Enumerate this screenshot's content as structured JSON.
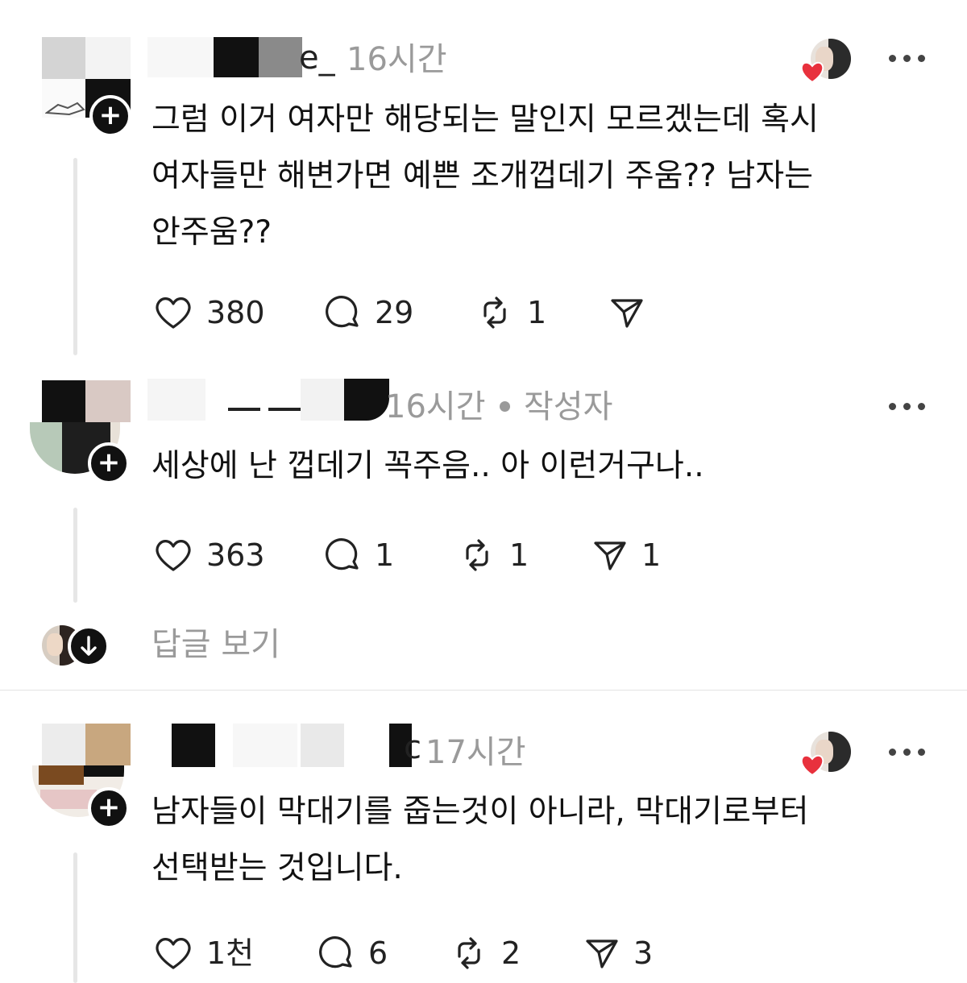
{
  "posts": [
    {
      "username": "e_",
      "time": "16시간",
      "body_lines": [
        "그럼 이거 여자만 해당되는 말인지 모르겠는데 혹시",
        "여자들만 해변가면 예쁜 조개껍데기 주움?? 남자는",
        "안주움??"
      ],
      "stats": {
        "likes": "380",
        "replies": "29",
        "reposts": "1"
      }
    },
    {
      "time": "16시간",
      "author_badge": "작성자",
      "body_lines": [
        "세상에 난 껍데기 꼭주음.. 아 이런거구나.."
      ],
      "stats": {
        "likes": "363",
        "replies": "1",
        "reposts": "1",
        "shares": "1"
      }
    },
    {
      "username": "c",
      "time": "17시간",
      "body_lines": [
        "남자들이 막대기를 줍는것이 아니라, 막대기로부터",
        "선택받는 것입니다."
      ],
      "stats": {
        "likes": "1천",
        "replies": "6",
        "reposts": "2",
        "shares": "3"
      }
    }
  ],
  "view_replies": "답글 보기",
  "icons": {
    "like": "heart-icon",
    "reply": "comment-icon",
    "repost": "repost-icon",
    "share": "send-icon",
    "more": "more-icon",
    "follow": "plus-icon",
    "expand": "arrow-down-icon"
  },
  "colors": {
    "liked_heart": "#e8313d",
    "muted_text": "#9a9a9a"
  }
}
